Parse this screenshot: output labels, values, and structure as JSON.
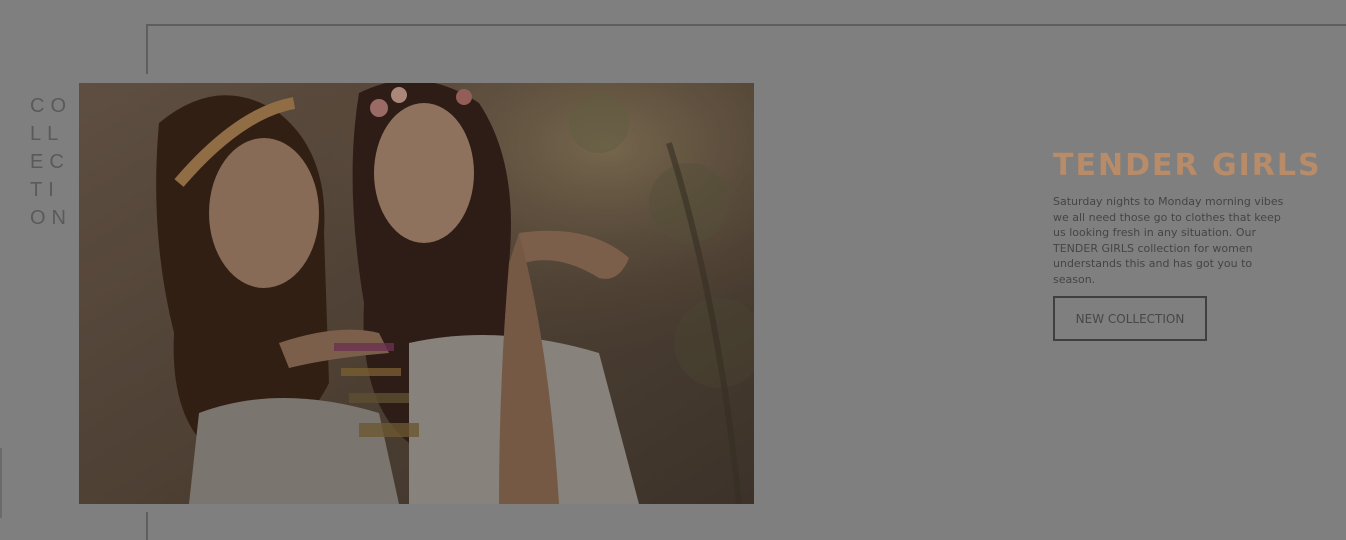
{
  "collection_letters": [
    "CO",
    "LL",
    "EC",
    "TI",
    "ON"
  ],
  "promo": {
    "title": "TENDER GIRLS",
    "description": "Saturday nights to Monday morning vibes we all need those go to clothes that keep us looking fresh in any situation. Our TENDER GIRLS collection for women understands this and has got you to season.",
    "button_label": "NEW COLLECTION"
  },
  "colors": {
    "overlay": "#7f7f7f",
    "accent": "#b88c68",
    "text": "#454545"
  },
  "image": {
    "subject": "two-girls-blowing-kiss-photo"
  }
}
